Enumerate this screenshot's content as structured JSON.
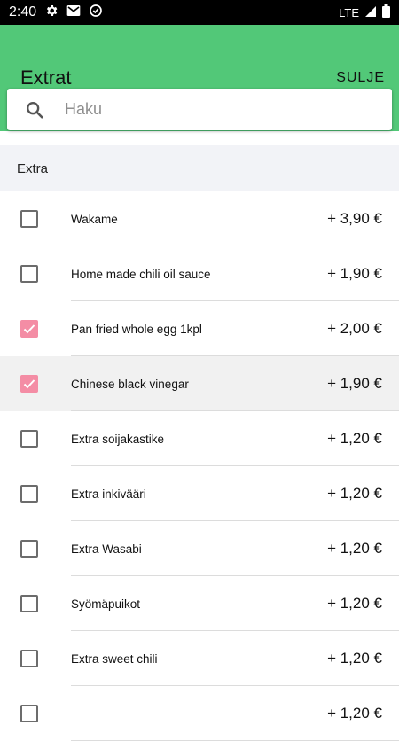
{
  "status_bar": {
    "time": "2:40",
    "network": "LTE"
  },
  "header": {
    "title": "Extrat",
    "close_label": "SULJE"
  },
  "search": {
    "placeholder": "Haku",
    "value": ""
  },
  "section": {
    "title": "Extra"
  },
  "items": [
    {
      "name": "Wakame",
      "price": "+ 3,90 €",
      "checked": false,
      "highlighted": false
    },
    {
      "name": "Home made chili oil sauce",
      "price": "+ 1,90 €",
      "checked": false,
      "highlighted": false
    },
    {
      "name": "Pan fried whole egg 1kpl",
      "price": "+ 2,00 €",
      "checked": true,
      "highlighted": false
    },
    {
      "name": "Chinese black vinegar",
      "price": "+ 1,90 €",
      "checked": true,
      "highlighted": true
    },
    {
      "name": "Extra soijakastike",
      "price": "+ 1,20 €",
      "checked": false,
      "highlighted": false
    },
    {
      "name": "Extra inkivääri",
      "price": "+ 1,20 €",
      "checked": false,
      "highlighted": false
    },
    {
      "name": "Extra Wasabi",
      "price": "+ 1,20 €",
      "checked": false,
      "highlighted": false
    },
    {
      "name": "Syömäpuikot",
      "price": "+ 1,20 €",
      "checked": false,
      "highlighted": false
    },
    {
      "name": "Extra sweet chili",
      "price": "+ 1,20 €",
      "checked": false,
      "highlighted": false
    },
    {
      "name": "",
      "price": "+ 1,20 €",
      "checked": false,
      "highlighted": false
    }
  ],
  "colors": {
    "header_bg": "#52c878",
    "checked": "#f48da5",
    "section_bg": "#f2f3f7"
  },
  "icons": [
    "gear-icon",
    "mail-icon",
    "sync-icon",
    "signal-icon",
    "battery-icon",
    "search-icon"
  ]
}
